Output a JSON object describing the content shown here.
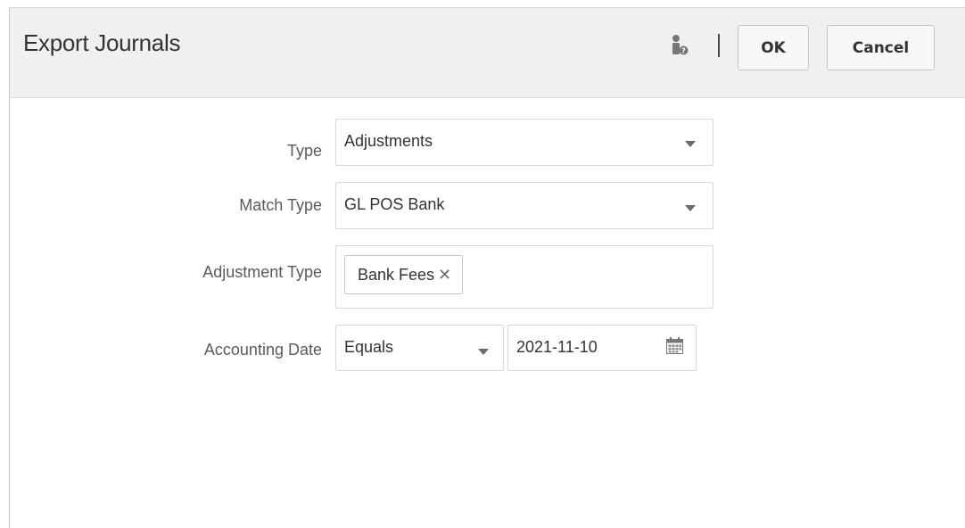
{
  "dialog": {
    "title": "Export Journals",
    "help_icon": "user-help-icon",
    "ok_label": "OK",
    "cancel_label": "Cancel"
  },
  "form": {
    "type": {
      "label": "Type",
      "value": "Adjustments"
    },
    "match_type": {
      "label": "Match Type",
      "value": "GL POS Bank"
    },
    "adjustment_type": {
      "label": "Adjustment Type",
      "chips": [
        "Bank Fees"
      ]
    },
    "accounting_date": {
      "label": "Accounting Date",
      "operator": "Equals",
      "date": "2021-11-10"
    }
  },
  "colors": {
    "header_bg": "#f0f0f0",
    "border": "#d8d8d8",
    "label_text": "#5a5a5a",
    "value_text": "#333333"
  }
}
